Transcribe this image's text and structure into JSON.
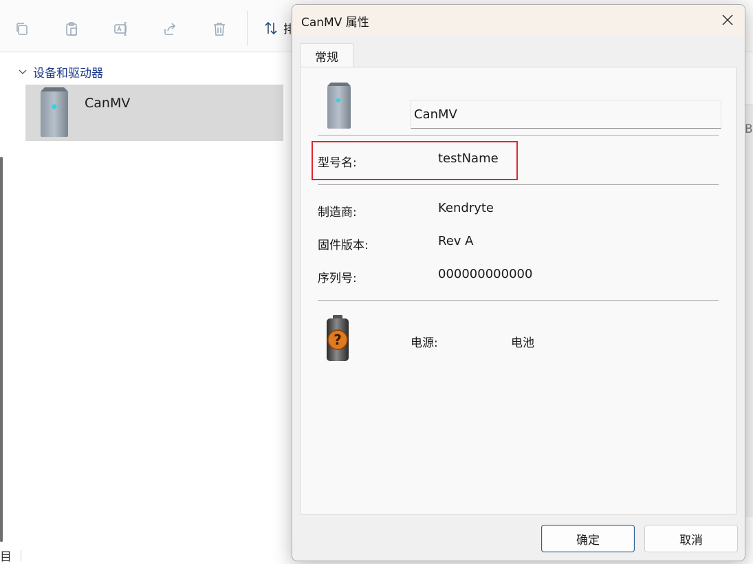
{
  "explorer": {
    "toolbar": {
      "icons": [
        "copy-icon",
        "paste-icon",
        "rename-icon",
        "share-icon",
        "delete-icon",
        "sort-icon"
      ],
      "sort_label_partial": "排"
    },
    "group_header": "设备和驱动器",
    "device_tile": {
      "name": "CanMV",
      "icon": "drive-icon"
    },
    "status_glyph": "目",
    "right_partial_letter": "B"
  },
  "dialog": {
    "title": "CanMV 属性",
    "tab_general": "常规",
    "device_name": "CanMV",
    "properties": {
      "model": {
        "label": "型号名:",
        "value": "testName"
      },
      "manufacturer": {
        "label": "制造商:",
        "value": "Kendryte"
      },
      "firmware": {
        "label": "固件版本:",
        "value": "Rev A"
      },
      "serial": {
        "label": "序列号:",
        "value": "000000000000"
      }
    },
    "power": {
      "label": "电源:",
      "value": "电池",
      "icon": "battery-unknown-icon"
    },
    "buttons": {
      "ok": "确定",
      "cancel": "取消"
    },
    "highlight_color": "#e0262f"
  },
  "colors": {
    "accent": "#1d3a8a",
    "tile_selected": "#d9d9d9",
    "title_bar": "#f7f1ea"
  }
}
